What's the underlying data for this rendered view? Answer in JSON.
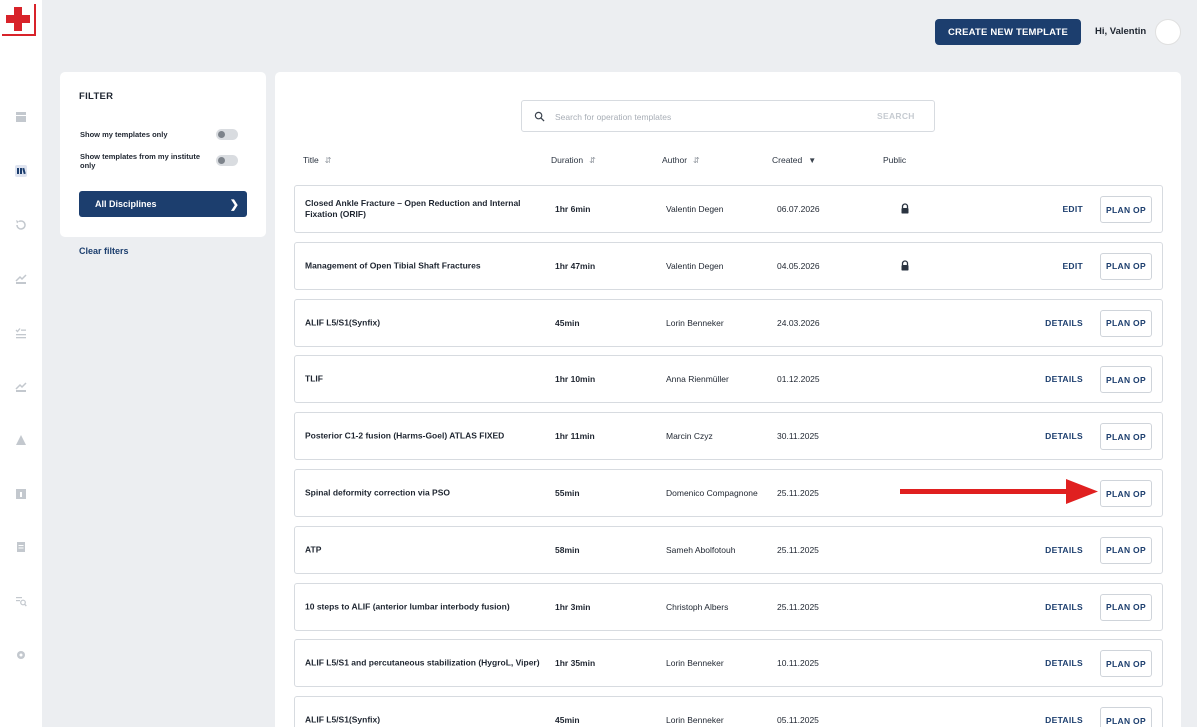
{
  "header": {
    "create_button": "CREATE NEW TEMPLATE",
    "greeting": "Hi, Valentin"
  },
  "brand_color": "#1c3e6e",
  "accent_red": "#d8232a",
  "rail": {
    "icons": [
      "table-icon",
      "library-icon",
      "history-icon",
      "hands-icon",
      "checklist-icon",
      "hands-icon",
      "warning-icon",
      "stats-icon",
      "document-icon",
      "search-list-icon",
      "gear-icon"
    ]
  },
  "filter": {
    "title": "FILTER",
    "toggle_my": "Show my templates only",
    "toggle_institute": "Show templates from my institute only",
    "disciplines": "All Disciplines",
    "clear": "Clear filters"
  },
  "search": {
    "placeholder": "Search for operation templates",
    "button": "SEARCH"
  },
  "columns": {
    "title": "Title",
    "duration": "Duration",
    "author": "Author",
    "created": "Created",
    "public": "Public"
  },
  "rows": [
    {
      "title": "Closed Ankle Fracture – Open Reduction and Internal Fixation (ORIF)",
      "duration": "1hr 6min",
      "author": "Valentin Degen",
      "created": "06.07.2026",
      "locked": true,
      "action": "EDIT",
      "plan": "PLAN OP"
    },
    {
      "title": "Management of Open Tibial Shaft Fractures",
      "duration": "1hr 47min",
      "author": "Valentin Degen",
      "created": "04.05.2026",
      "locked": true,
      "action": "EDIT",
      "plan": "PLAN OP"
    },
    {
      "title": "ALIF L5/S1(Synfix)",
      "duration": "45min",
      "author": "Lorin Benneker",
      "created": "24.03.2026",
      "locked": false,
      "action": "DETAILS",
      "plan": "PLAN OP"
    },
    {
      "title": "TLIF",
      "duration": "1hr 10min",
      "author": "Anna Rienmüller",
      "created": "01.12.2025",
      "locked": false,
      "action": "DETAILS",
      "plan": "PLAN OP"
    },
    {
      "title": "Posterior C1-2 fusion (Harms-Goel) ATLAS FIXED",
      "duration": "1hr 11min",
      "author": "Marcin Czyz",
      "created": "30.11.2025",
      "locked": false,
      "action": "DETAILS",
      "plan": "PLAN OP"
    },
    {
      "title": "Spinal deformity correction via PSO",
      "duration": "55min",
      "author": "Domenico Compagnone",
      "created": "25.11.2025",
      "locked": false,
      "action": "",
      "plan": "PLAN OP"
    },
    {
      "title": "ATP",
      "duration": "58min",
      "author": "Sameh Abolfotouh",
      "created": "25.11.2025",
      "locked": false,
      "action": "DETAILS",
      "plan": "PLAN OP"
    },
    {
      "title": "10 steps to ALIF (anterior lumbar interbody fusion)",
      "duration": "1hr 3min",
      "author": "Christoph Albers",
      "created": "25.11.2025",
      "locked": false,
      "action": "DETAILS",
      "plan": "PLAN OP"
    },
    {
      "title": "ALIF L5/S1 and percutaneous stabilization (HygroL, Viper)",
      "duration": "1hr 35min",
      "author": "Lorin Benneker",
      "created": "10.11.2025",
      "locked": false,
      "action": "DETAILS",
      "plan": "PLAN OP"
    },
    {
      "title": "ALIF L5/S1(Synfix)",
      "duration": "45min",
      "author": "Lorin Benneker",
      "created": "05.11.2025",
      "locked": false,
      "action": "DETAILS",
      "plan": "PLAN OP"
    }
  ]
}
